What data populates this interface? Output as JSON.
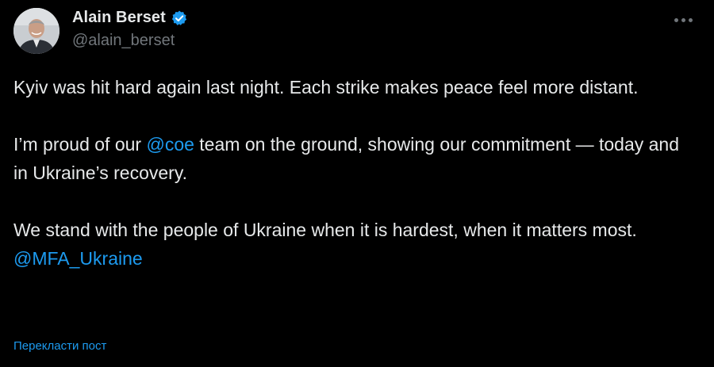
{
  "author": {
    "display_name": "Alain Berset",
    "handle": "@alain_berset",
    "avatar_icon": "profile-photo",
    "verified_icon": "verified-badge-icon",
    "verified_color": "#1d9bf0"
  },
  "menu": {
    "icon": "more-horizontal-icon"
  },
  "tweet": {
    "p1": "Kyiv was hit hard again last night. Each strike makes peace feel more distant.",
    "p2_before": "I’m proud of our ",
    "p2_mention": "@coe",
    "p2_after": " team on the ground, showing our commitment — today and in Ukraine’s recovery.",
    "p3": "We stand with the people of Ukraine when it is hardest, when it matters most.",
    "p3_mention": "@MFA_Ukraine"
  },
  "translate": {
    "label": "Перекласти пост"
  },
  "colors": {
    "background": "#000000",
    "text": "#e7e9ea",
    "secondary": "#71767b",
    "accent": "#1d9bf0"
  }
}
